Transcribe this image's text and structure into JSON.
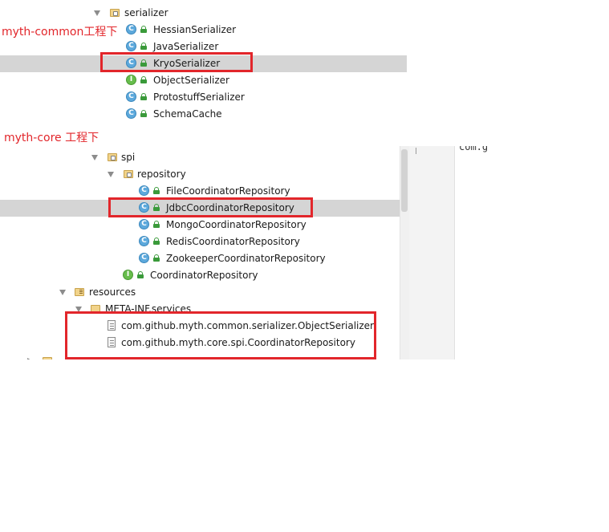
{
  "top_panel": {
    "serializer_folder": "serializer",
    "items": [
      {
        "label": "HessianSerializer",
        "kind": "C"
      },
      {
        "label": "JavaSerializer",
        "kind": "C"
      },
      {
        "label": "KryoSerializer",
        "kind": "C",
        "selected": true
      },
      {
        "label": "ObjectSerializer",
        "kind": "I"
      },
      {
        "label": "ProtostuffSerializer",
        "kind": "C"
      },
      {
        "label": "SchemaCache",
        "kind": "C"
      }
    ]
  },
  "bottom_panel": {
    "spi_folder": "spi",
    "repository_folder": "repository",
    "repo_items": [
      {
        "label": "FileCoordinatorRepository",
        "kind": "C"
      },
      {
        "label": "JdbcCoordinatorRepository",
        "kind": "C",
        "selected": true
      },
      {
        "label": "MongoCoordinatorRepository",
        "kind": "C"
      },
      {
        "label": "RedisCoordinatorRepository",
        "kind": "C"
      },
      {
        "label": "ZookeeperCoordinatorRepository",
        "kind": "C"
      }
    ],
    "coordinator_item": {
      "label": "CoordinatorRepository",
      "kind": "I"
    },
    "resources_folder": "resources",
    "meta_inf_folder": "META-INF.services",
    "service_files": [
      "com.github.myth.common.serializer.ObjectSerializer",
      "com.github.myth.core.spi.CoordinatorRepository"
    ],
    "editor_snippet": "com.g"
  },
  "annotations": {
    "common": "myth-common工程下",
    "core": "myth-core 工程下"
  },
  "colors": {
    "annotation_red": "#e2262b",
    "selection_gray": "#d5d5d5",
    "class_icon_blue": "#5da9dc",
    "interface_icon_green": "#67bd4c"
  }
}
